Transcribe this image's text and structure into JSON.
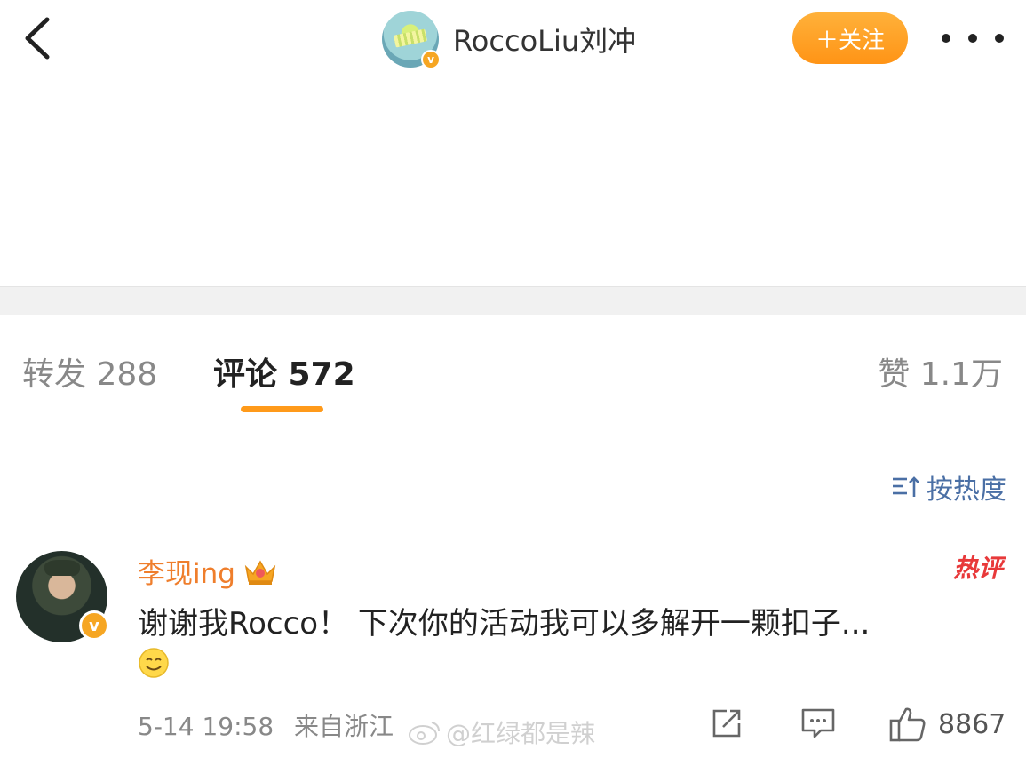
{
  "header": {
    "username": "RoccoLiu刘冲",
    "follow_label": "＋关注"
  },
  "tabs": {
    "repost": "转发 288",
    "comments": "评论 572",
    "likes": "赞 1.1万"
  },
  "sort": {
    "label": "按热度"
  },
  "comment": {
    "author": "李现ing",
    "hot_label": "热评",
    "text": "谢谢我Rocco！ 下次你的活动我可以多解开一颗扣子...",
    "timestamp": "5-14 19:58",
    "location": "来自浙江",
    "likes": "8867"
  },
  "watermark": {
    "text": "@红绿都是辣"
  },
  "colors": {
    "accent_orange": "#ff9a1a",
    "name_orange": "#ef7e2c",
    "link_blue": "#4a6fa5",
    "hot_red": "#e8393a"
  }
}
